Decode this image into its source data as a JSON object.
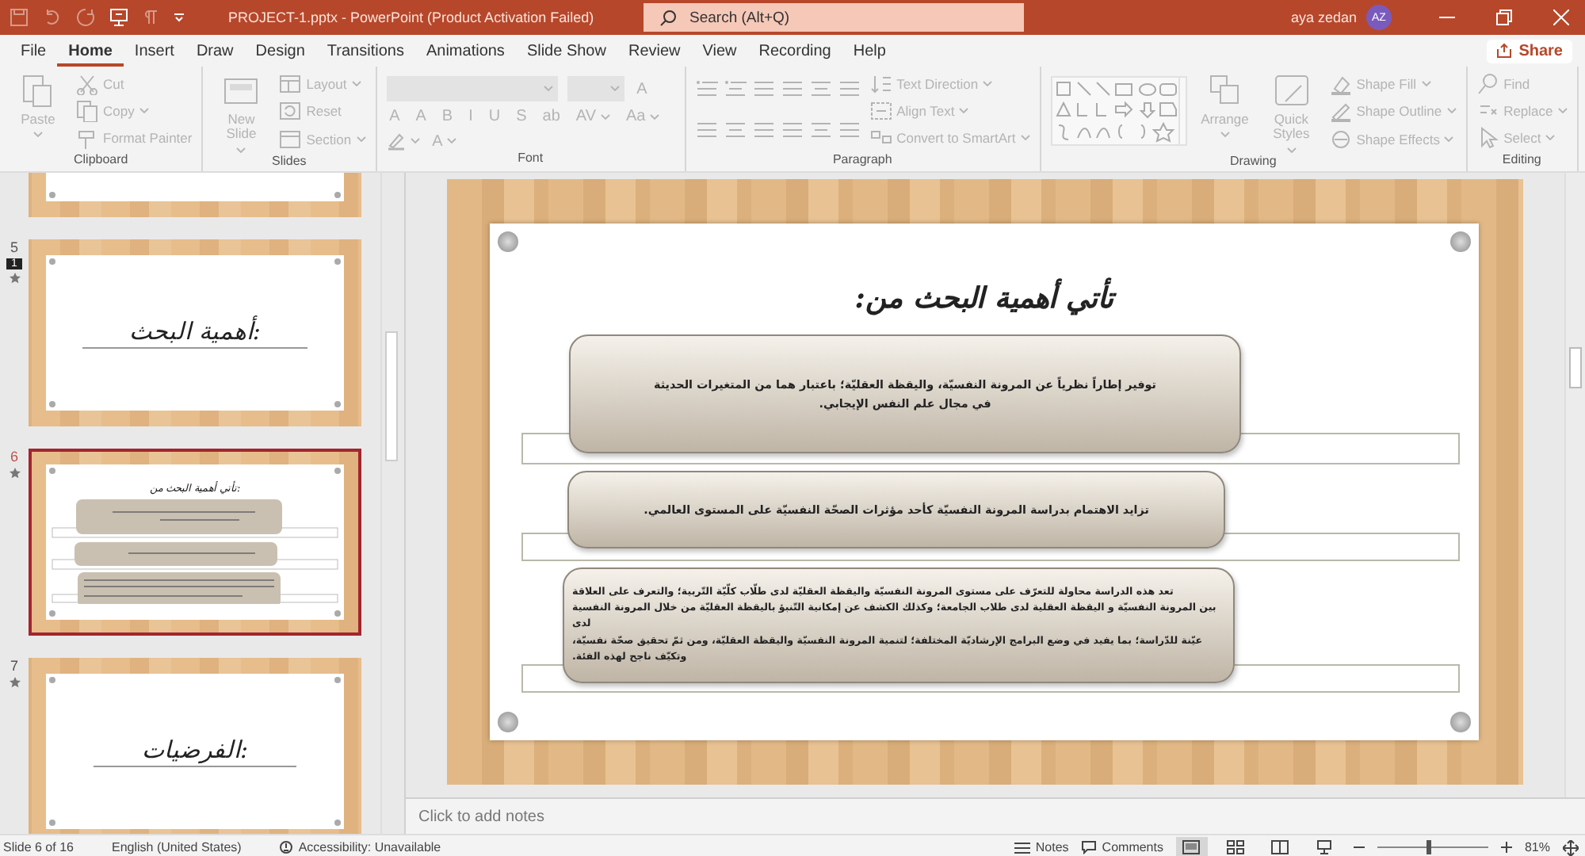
{
  "title_bar": {
    "title": "PROJECT-1.pptx  -  PowerPoint (Product Activation Failed)",
    "search": {
      "placeholder": "Search (Alt+Q)"
    },
    "user": "aya zedan",
    "avatar": "AZ"
  },
  "tabs": [
    {
      "label": "File",
      "selected": false
    },
    {
      "label": "Home",
      "selected": true
    },
    {
      "label": "Insert",
      "selected": false
    },
    {
      "label": "Draw",
      "selected": false
    },
    {
      "label": "Design",
      "selected": false
    },
    {
      "label": "Transitions",
      "selected": false
    },
    {
      "label": "Animations",
      "selected": false
    },
    {
      "label": "Slide Show",
      "selected": false
    },
    {
      "label": "Review",
      "selected": false
    },
    {
      "label": "View",
      "selected": false
    },
    {
      "label": "Recording",
      "selected": false
    },
    {
      "label": "Help",
      "selected": false
    }
  ],
  "share": "Share",
  "ribbon": [
    {
      "label": "Clipboard",
      "kind": "clipboard",
      "commands": [
        {
          "label": "Paste",
          "kind": "large",
          "disabled": true,
          "menu": true
        },
        {
          "label": "Cut",
          "kind": "small",
          "disabled": true,
          "menu": false
        },
        {
          "label": "Copy",
          "kind": "small",
          "disabled": true,
          "menu": true
        },
        {
          "label": "Format Painter",
          "kind": "small",
          "disabled": true,
          "menu": false
        }
      ]
    },
    {
      "label": "Slides",
      "kind": "slides",
      "commands": [
        {
          "label": "New Slide",
          "kind": "large",
          "disabled": true,
          "menu": true
        },
        {
          "label": "Layout",
          "kind": "small",
          "disabled": true,
          "menu": true
        },
        {
          "label": "Reset",
          "kind": "small",
          "disabled": true,
          "menu": false
        },
        {
          "label": "Section",
          "kind": "small",
          "disabled": true,
          "menu": true
        }
      ]
    },
    {
      "label": "Font",
      "kind": "font",
      "commands": [
        {
          "kind": "field",
          "disabled": true,
          "menu": true
        },
        {
          "kind": "field-small",
          "disabled": true,
          "menu": true
        },
        {
          "label": "A",
          "kind": "glyph",
          "disabled": true,
          "menu": false
        },
        {
          "label": "A",
          "kind": "glyph",
          "disabled": true,
          "menu": false
        },
        {
          "label": "A",
          "kind": "glyph",
          "disabled": true,
          "menu": false
        },
        {
          "label": "B",
          "kind": "glyph",
          "disabled": true,
          "menu": false
        },
        {
          "label": "I",
          "kind": "glyph",
          "disabled": true,
          "menu": false
        },
        {
          "label": "U",
          "kind": "glyph",
          "disabled": true,
          "menu": false
        },
        {
          "label": "S",
          "kind": "glyph",
          "disabled": true,
          "menu": false
        },
        {
          "label": "ab",
          "kind": "glyph",
          "disabled": true,
          "menu": false
        },
        {
          "label": "AV",
          "kind": "glyph",
          "disabled": true,
          "menu": true
        },
        {
          "label": "Aa",
          "kind": "glyph",
          "disabled": true,
          "menu": true
        },
        {
          "kind": "highlighter",
          "disabled": true,
          "menu": true
        },
        {
          "label": "A",
          "kind": "glyph",
          "disabled": true,
          "menu": true
        }
      ]
    },
    {
      "label": "Paragraph",
      "kind": "paragraph",
      "commands": [
        {
          "label": "Text Direction",
          "kind": "small",
          "disabled": true,
          "menu": true
        },
        {
          "label": "Align Text",
          "kind": "small",
          "disabled": true,
          "menu": true
        },
        {
          "label": "Convert to SmartArt",
          "kind": "small",
          "disabled": true,
          "menu": true
        }
      ]
    },
    {
      "label": "Drawing",
      "kind": "drawing",
      "commands": [
        {
          "label": "Arrange",
          "kind": "large",
          "disabled": true,
          "menu": true
        },
        {
          "label": "Quick Styles",
          "kind": "large",
          "disabled": true,
          "menu": true
        },
        {
          "label": "Shape Fill",
          "kind": "small",
          "disabled": true,
          "menu": true
        },
        {
          "label": "Shape Outline",
          "kind": "small",
          "disabled": true,
          "menu": true
        },
        {
          "label": "Shape Effects",
          "kind": "small",
          "disabled": true,
          "menu": true
        }
      ]
    },
    {
      "label": "Editing",
      "kind": "editing",
      "commands": [
        {
          "label": "Find",
          "kind": "small",
          "disabled": true,
          "menu": false
        },
        {
          "label": "Replace",
          "kind": "small",
          "disabled": true,
          "menu": true
        },
        {
          "label": "Select",
          "kind": "small",
          "disabled": true,
          "menu": true
        }
      ]
    }
  ],
  "thumbnails": [
    {
      "kind": "partial",
      "selected": false
    },
    {
      "kind": "title",
      "number": "5",
      "comments": "1",
      "title": "أهمية البحث:",
      "selected": false
    },
    {
      "kind": "content",
      "number": "6",
      "title": "تأتي أهمية البحث من:",
      "selected": true
    },
    {
      "kind": "title",
      "number": "7",
      "title": "الفرضيات:",
      "selected": false
    }
  ],
  "slide": {
    "title": "تأتي أهمية البحث من:",
    "boxes": [
      {
        "lines": [
          "توفير إطاراً نظرياً عن المرونة النفسيّة، واليقظة العقليّة؛ باعتبار هما من المتغيرات الحديثة",
          "في مجال علم النفس الإيجابي."
        ]
      },
      {
        "lines": [
          "تزايد الاهتمام بدراسة المرونة النفسيّة كأحد مؤثرات الصحّة النفسيّة على المستوى العالمي."
        ]
      },
      {
        "lines": [
          "تعد هذه الدراسة محاولة للتعرّف على مستوى المرونة النفسيّة واليقظة العقليّة لدى طلّاب كلّيّة التّربية؛ والتعرف على العلاقة",
          "بين المرونة النفسيّة و اليقظة العقلية لدى طلاب الجامعة؛ وكذلك الكشف عن إمكانية التّنبؤ باليقظة العقليّة من خلال المرونة النفسية",
          "لدى",
          "عيّنة للدّراسة؛ بما يفيد في وضع البرامج الإرشاديّة المختلفة؛ لتنمية المرونة النفسيّة واليقظة العقليّة، ومن ثمّ تحقيق صحّة نفسيّة،",
          "وتكيّف ناجح لهذه الفئة."
        ]
      }
    ]
  },
  "notes": {
    "placeholder": "Click to add notes"
  },
  "status_bar": {
    "slide": "Slide 6 of 16",
    "language": "English (United States)",
    "accessibility": "Accessibility: Unavailable",
    "notes": "Notes",
    "comments": "Comments",
    "views": [
      {
        "selected": true
      },
      {
        "selected": false
      },
      {
        "selected": false
      },
      {
        "selected": false
      }
    ],
    "zoom": {
      "level": 0.45
    },
    "zoom_text": "81%"
  }
}
